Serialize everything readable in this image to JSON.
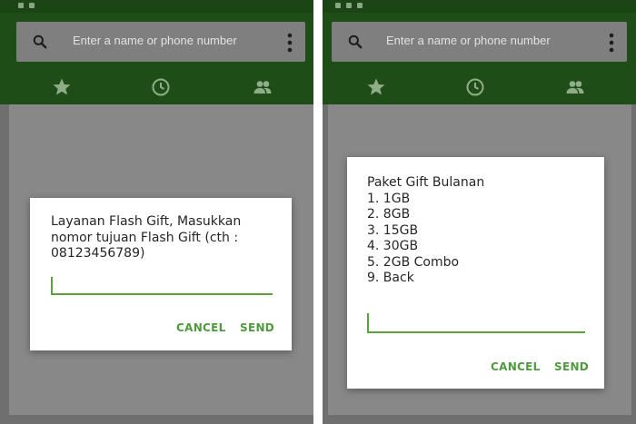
{
  "colors": {
    "accent": "#4f9a3e",
    "appbar": "#1e4d17",
    "scrim": "#888888"
  },
  "search": {
    "placeholder": "Enter a name or phone number"
  },
  "tabs": {
    "icons": [
      "star-icon",
      "clock-icon",
      "people-icon"
    ]
  },
  "dialog_left": {
    "message": "Layanan Flash Gift, Masukkan nomor tujuan Flash Gift (cth : 08123456789)",
    "input_value": "",
    "cancel_label": "CANCEL",
    "send_label": "SEND"
  },
  "dialog_right": {
    "title": "Paket Gift Bulanan",
    "options": [
      "1. 1GB",
      "2. 8GB",
      "3. 15GB",
      "4. 30GB",
      "5. 2GB Combo",
      "9. Back"
    ],
    "input_value": "",
    "cancel_label": "CANCEL",
    "send_label": "SEND"
  }
}
